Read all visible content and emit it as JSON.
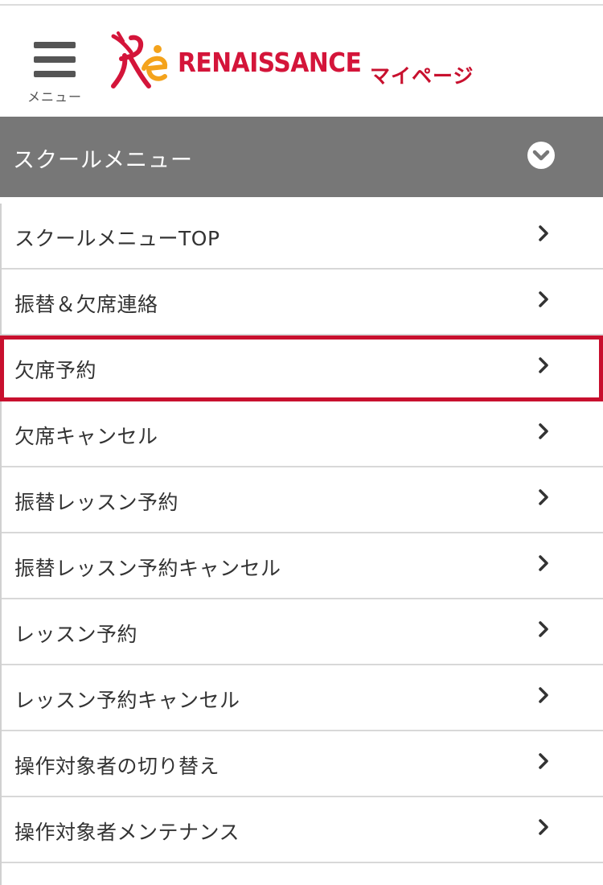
{
  "header": {
    "menu_label": "メニュー",
    "brand_name": "RENAISSANCE",
    "mypage_label": "マイページ",
    "menu_icon": "hamburger-icon",
    "logo_icon": "renaissance-logo-mark"
  },
  "section": {
    "title": "スクールメニュー",
    "toggle_icon": "chevron-down-circle-icon"
  },
  "menu": {
    "items": [
      {
        "label": "スクールメニューTOP"
      },
      {
        "label": "振替＆欠席連絡"
      },
      {
        "label": "欠席予約",
        "selected": true
      },
      {
        "label": "欠席キャンセル"
      },
      {
        "label": "振替レッスン予約"
      },
      {
        "label": "振替レッスン予約キャンセル"
      },
      {
        "label": "レッスン予約"
      },
      {
        "label": "レッスン予約キャンセル"
      },
      {
        "label": "操作対象者の切り替え"
      },
      {
        "label": "操作対象者メンテナンス"
      }
    ],
    "item_icon": "chevron-right-icon"
  },
  "colors": {
    "brand_red": "#d4153a",
    "highlight_border": "#c8102e",
    "section_bar": "#777777",
    "logo_yellow": "#f4a31c"
  }
}
